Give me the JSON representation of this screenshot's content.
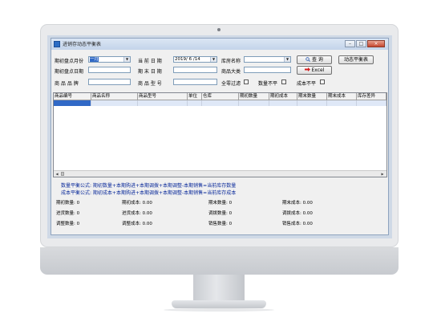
{
  "window": {
    "title": "进销存动态平衡表",
    "minimize_glyph": "–",
    "maximize_glyph": "□",
    "close_glyph": "×"
  },
  "filters": {
    "period_month_label": "期初盘点月份",
    "period_month_value": "一月",
    "current_date_label": "当 前 日 期",
    "current_date_value": "2019/ 6 /14",
    "warehouse_label": "库房名称",
    "warehouse_value": "",
    "query_button": "查 询",
    "dynamic_balance_button": "动态平衡表",
    "period_date_label": "期初盘点日期",
    "period_date_value": "",
    "end_date_label": "期 末 日 期",
    "end_date_value": "",
    "product_category_label": "商品大类",
    "product_category_value": "",
    "excel_button": "Excel",
    "brand_label": "商 品 品 牌",
    "brand_value": "",
    "model_label": "商 品 型 号",
    "model_value": "",
    "zero_filter_label": "全零过滤",
    "qty_unbalanced_label": "数量不平",
    "cost_unbalanced_label": "成本不平"
  },
  "table": {
    "columns": [
      "商品编号",
      "商品名称",
      "商品型号",
      "单位",
      "仓库",
      "期初数量",
      "期初成本",
      "期末数量",
      "期末成本",
      "库存差异"
    ],
    "rows": [
      [
        "",
        "",
        "",
        "",
        "",
        "",
        "",
        "",
        "",
        ""
      ]
    ]
  },
  "formulas": {
    "quantity": "数量平衡公式: 期初数量+本期购进+本期调拨+本期调整-本期销售=当前库存数量",
    "cost": "成本平衡公式: 期初成本+本期购进+本期调拨+本期调整-本期销售=当前库存成本"
  },
  "stats": {
    "opening_qty": "期初数量: 0",
    "opening_cost": "期初成本: 0.00",
    "closing_qty": "期末数量: 0",
    "closing_cost": "期末成本: 0.00",
    "purchase_qty": "进货数量: 0",
    "purchase_cost": "进货成本: 0.00",
    "transfer_qty": "调拨数量: 0",
    "transfer_cost": "调拨成本: 0.00",
    "adjust_qty": "调整数量: 0",
    "adjust_cost": "调整成本: 0.00",
    "sales_qty": "销售数量: 0",
    "sales_cost": "销售成本: 0.00"
  },
  "icons": {
    "app": "app-icon",
    "search": "magnifier-icon",
    "excel": "red-arrow-icon",
    "dropdown": "chevron-down-icon"
  },
  "colors": {
    "formula_text": "#0a2a9a",
    "selection": "#3169c6",
    "titlebar": "#c3d4ea"
  }
}
